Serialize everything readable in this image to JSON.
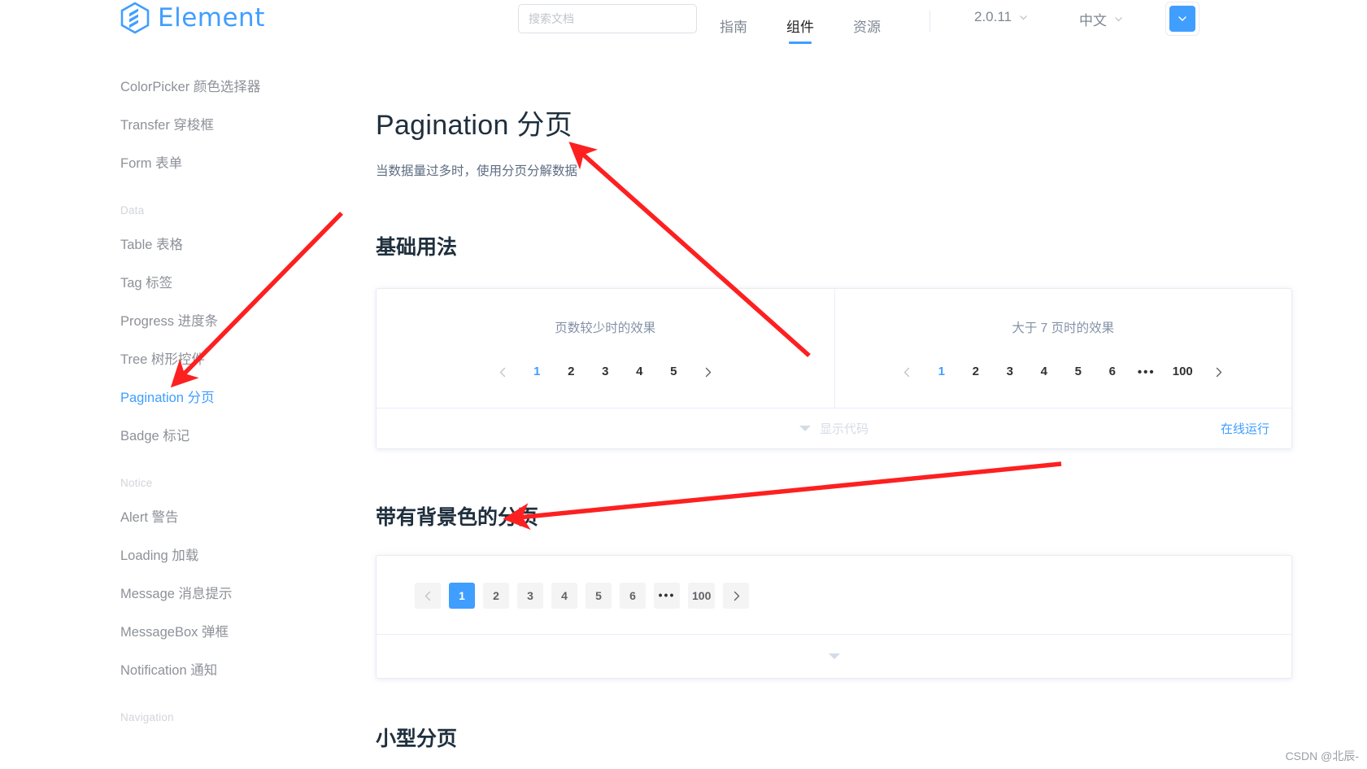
{
  "header": {
    "brand": "Element",
    "logo_icon": "element-hexagon-logo",
    "search": {
      "placeholder": "搜索文档",
      "value": "",
      "icon": "search-input"
    },
    "nav": [
      {
        "label": "指南",
        "active": false
      },
      {
        "label": "组件",
        "active": true
      },
      {
        "label": "资源",
        "active": false
      }
    ],
    "version": {
      "label": "2.0.11",
      "icon": "chevron-down-icon"
    },
    "language": {
      "label": "中文",
      "icon": "chevron-down-icon"
    },
    "theme_button": {
      "icon": "chevron-down-icon",
      "color": "#409EFF"
    }
  },
  "sidebar": {
    "items": [
      {
        "label": "ColorPicker 颜色选择器",
        "type": "link",
        "active": false
      },
      {
        "label": "Transfer 穿梭框",
        "type": "link",
        "active": false
      },
      {
        "label": "Form 表单",
        "type": "link",
        "active": false
      },
      {
        "label": "Data",
        "type": "group"
      },
      {
        "label": "Table 表格",
        "type": "link",
        "active": false
      },
      {
        "label": "Tag 标签",
        "type": "link",
        "active": false
      },
      {
        "label": "Progress 进度条",
        "type": "link",
        "active": false
      },
      {
        "label": "Tree 树形控件",
        "type": "link",
        "active": false
      },
      {
        "label": "Pagination 分页",
        "type": "link",
        "active": true
      },
      {
        "label": "Badge 标记",
        "type": "link",
        "active": false
      },
      {
        "label": "Notice",
        "type": "group"
      },
      {
        "label": "Alert 警告",
        "type": "link",
        "active": false
      },
      {
        "label": "Loading 加载",
        "type": "link",
        "active": false
      },
      {
        "label": "Message 消息提示",
        "type": "link",
        "active": false
      },
      {
        "label": "MessageBox 弹框",
        "type": "link",
        "active": false
      },
      {
        "label": "Notification 通知",
        "type": "link",
        "active": false
      },
      {
        "label": "Navigation",
        "type": "group"
      }
    ]
  },
  "main": {
    "title": "Pagination 分页",
    "subtitle": "当数据量过多时，使用分页分解数据",
    "section1": {
      "title": "基础用法",
      "left_caption": "页数较少时的效果",
      "right_caption": "大于 7 页时的效果",
      "left_pager": {
        "prev_icon": "chevron-left-icon",
        "next_icon": "chevron-right-icon",
        "pages": [
          "1",
          "2",
          "3",
          "4",
          "5"
        ],
        "current": "1"
      },
      "right_pager": {
        "prev_icon": "chevron-left-icon",
        "next_icon": "chevron-right-icon",
        "pages": [
          "1",
          "2",
          "3",
          "4",
          "5",
          "6",
          "…",
          "100"
        ],
        "ellipsis": "•••",
        "current": "1"
      },
      "footer": {
        "show_code": "显示代码",
        "show_code_icon": "triangle-down-icon",
        "online_run": "在线运行"
      }
    },
    "section2": {
      "title": "带有背景色的分页",
      "pager": {
        "prev_icon": "chevron-left-icon",
        "next_icon": "chevron-right-icon",
        "pages": [
          "1",
          "2",
          "3",
          "4",
          "5",
          "6",
          "…",
          "100"
        ],
        "ellipsis": "•••",
        "current": "1"
      },
      "footer_icon": "triangle-down-icon"
    },
    "section3": {
      "title": "小型分页"
    }
  },
  "annotations": {
    "arrow_color": "#ff0000",
    "arrows": [
      {
        "name": "arrow-to-sidebar-pagination"
      },
      {
        "name": "arrow-to-page-title"
      },
      {
        "name": "arrow-to-background-pagination"
      }
    ]
  },
  "watermark": "CSDN @北辰-"
}
